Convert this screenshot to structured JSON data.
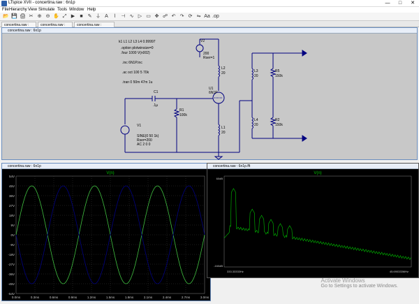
{
  "app": {
    "title": "LTspice XVII - concertina.raw : 6n1p",
    "icon": "ltspice-icon"
  },
  "window_controls": [
    "—",
    "□",
    "✕"
  ],
  "menu": [
    "File",
    "Hierarchy",
    "View",
    "Simulate",
    "Tools",
    "Window",
    "Help"
  ],
  "toolbar_icons": [
    "open-icon",
    "save-icon",
    "print-icon",
    "cut-icon",
    "zoom-in-icon",
    "zoom-out-icon",
    "pan-icon",
    "autorange-icon",
    "run-icon",
    "halt-icon",
    "wire-icon",
    "ground-icon",
    "label-icon",
    "resistor-icon",
    "capacitor-icon",
    "inductor-icon",
    "diode-icon",
    "component-icon",
    "move-icon",
    "drag-icon",
    "undo-icon",
    "redo-icon",
    "rotate-icon",
    "mirror-icon",
    "text-icon",
    "spice-directive-icon"
  ],
  "tabs": [
    "concertina.raw : 6n1p",
    "concertina.raw : 6n1p",
    "concertina.raw : 6n1p.fft"
  ],
  "schematic": {
    "title": "concertina.raw : 6n1p",
    "directives": [
      "k1 L1 L2 L3 L4 0.99997",
      ".option plotwinsize=0",
      ".four 1000 V(n002)",
      ".inc 6N1P.inc",
      ".ac oct 100 5 70k",
      ".tran 0 50m 47m 1u"
    ],
    "v2": {
      "name": "V2",
      "value": "200",
      "rser": "Rser=1"
    },
    "v1": {
      "name": "V1",
      "value": "SINE(0 50 1k)",
      "rser": "Rser=200",
      "ac": "AC 2 0 0"
    },
    "c1": {
      "name": "C1",
      "value": ".1µ"
    },
    "r1": {
      "name": "R1",
      "value": "100k"
    },
    "u1": {
      "name": "U1",
      "value": "6N1P"
    },
    "l1": {
      "name": "L1",
      "value": "20"
    },
    "l2": {
      "name": "L2",
      "value": "20"
    },
    "l3": {
      "name": "L3",
      "value": "20"
    },
    "l4": {
      "name": "L4",
      "value": "20"
    },
    "r5": {
      "name": "R5",
      "value": "150k"
    },
    "r2": {
      "name": "R2",
      "value": "150k"
    }
  },
  "time_plot": {
    "title": "V(n)",
    "title_color": "#00c000",
    "yticks": [
      "54V",
      "45V",
      "36V",
      "27V",
      "18V",
      "9V",
      "0V",
      "-9V",
      "-18V",
      "-27V",
      "-36V",
      "-45V",
      "-54V"
    ],
    "xticks": [
      "0.0ms",
      "0.3ms",
      "0.6ms",
      "0.9ms",
      "1.2ms",
      "1.5ms",
      "1.8ms",
      "2.1ms",
      "2.4ms",
      "2.7ms",
      "3.0ms"
    ]
  },
  "fft_plot": {
    "window_title": "concertina.raw : 6n1p.fft",
    "title": "V(n)",
    "y_top": "60dB",
    "y_bottom": "-160dB",
    "x_left": "333.33333Hz",
    "x_right": "45.690333MHz"
  },
  "chart_data": [
    {
      "type": "line",
      "title": "V(n)",
      "xlabel": "",
      "ylabel": "",
      "xlim": [
        0,
        3.0
      ],
      "ylim": [
        -54,
        54
      ],
      "series": [
        {
          "color": "#40c040",
          "amplitude": 45,
          "frequency_khz": 1.0,
          "phase_deg": 0,
          "x": [
            0,
            0.25,
            0.5,
            0.75,
            1.0,
            1.25,
            1.5,
            1.75,
            2.0,
            2.25,
            2.5,
            2.75,
            3.0
          ],
          "values": [
            0,
            45,
            0,
            -45,
            0,
            45,
            0,
            -45,
            0,
            45,
            0,
            -45,
            0
          ]
        },
        {
          "color": "#000080",
          "amplitude": 45,
          "frequency_khz": 1.0,
          "phase_deg": 180,
          "x": [
            0,
            0.25,
            0.5,
            0.75,
            1.0,
            1.25,
            1.5,
            1.75,
            2.0,
            2.25,
            2.5,
            2.75,
            3.0
          ],
          "values": [
            0,
            -45,
            0,
            45,
            0,
            -45,
            0,
            45,
            0,
            -45,
            0,
            45,
            0
          ]
        }
      ]
    },
    {
      "type": "line",
      "title": "V(n)",
      "xlabel": "",
      "ylabel": "",
      "ylim": [
        -160,
        60
      ],
      "series": [
        {
          "color": "#00c000",
          "x": [
            0.02,
            0.05,
            0.1,
            0.15,
            0.2,
            0.25,
            0.3,
            0.35,
            0.4,
            0.5,
            0.6,
            0.7,
            0.8,
            0.9,
            1.0
          ],
          "values": [
            -80,
            30,
            -60,
            -20,
            -70,
            -35,
            -80,
            -50,
            -90,
            -100,
            -110,
            -118,
            -126,
            -134,
            -142
          ]
        }
      ]
    }
  ],
  "watermark": {
    "line1": "Activate Windows",
    "line2": "Go to Settings to activate Windows."
  }
}
